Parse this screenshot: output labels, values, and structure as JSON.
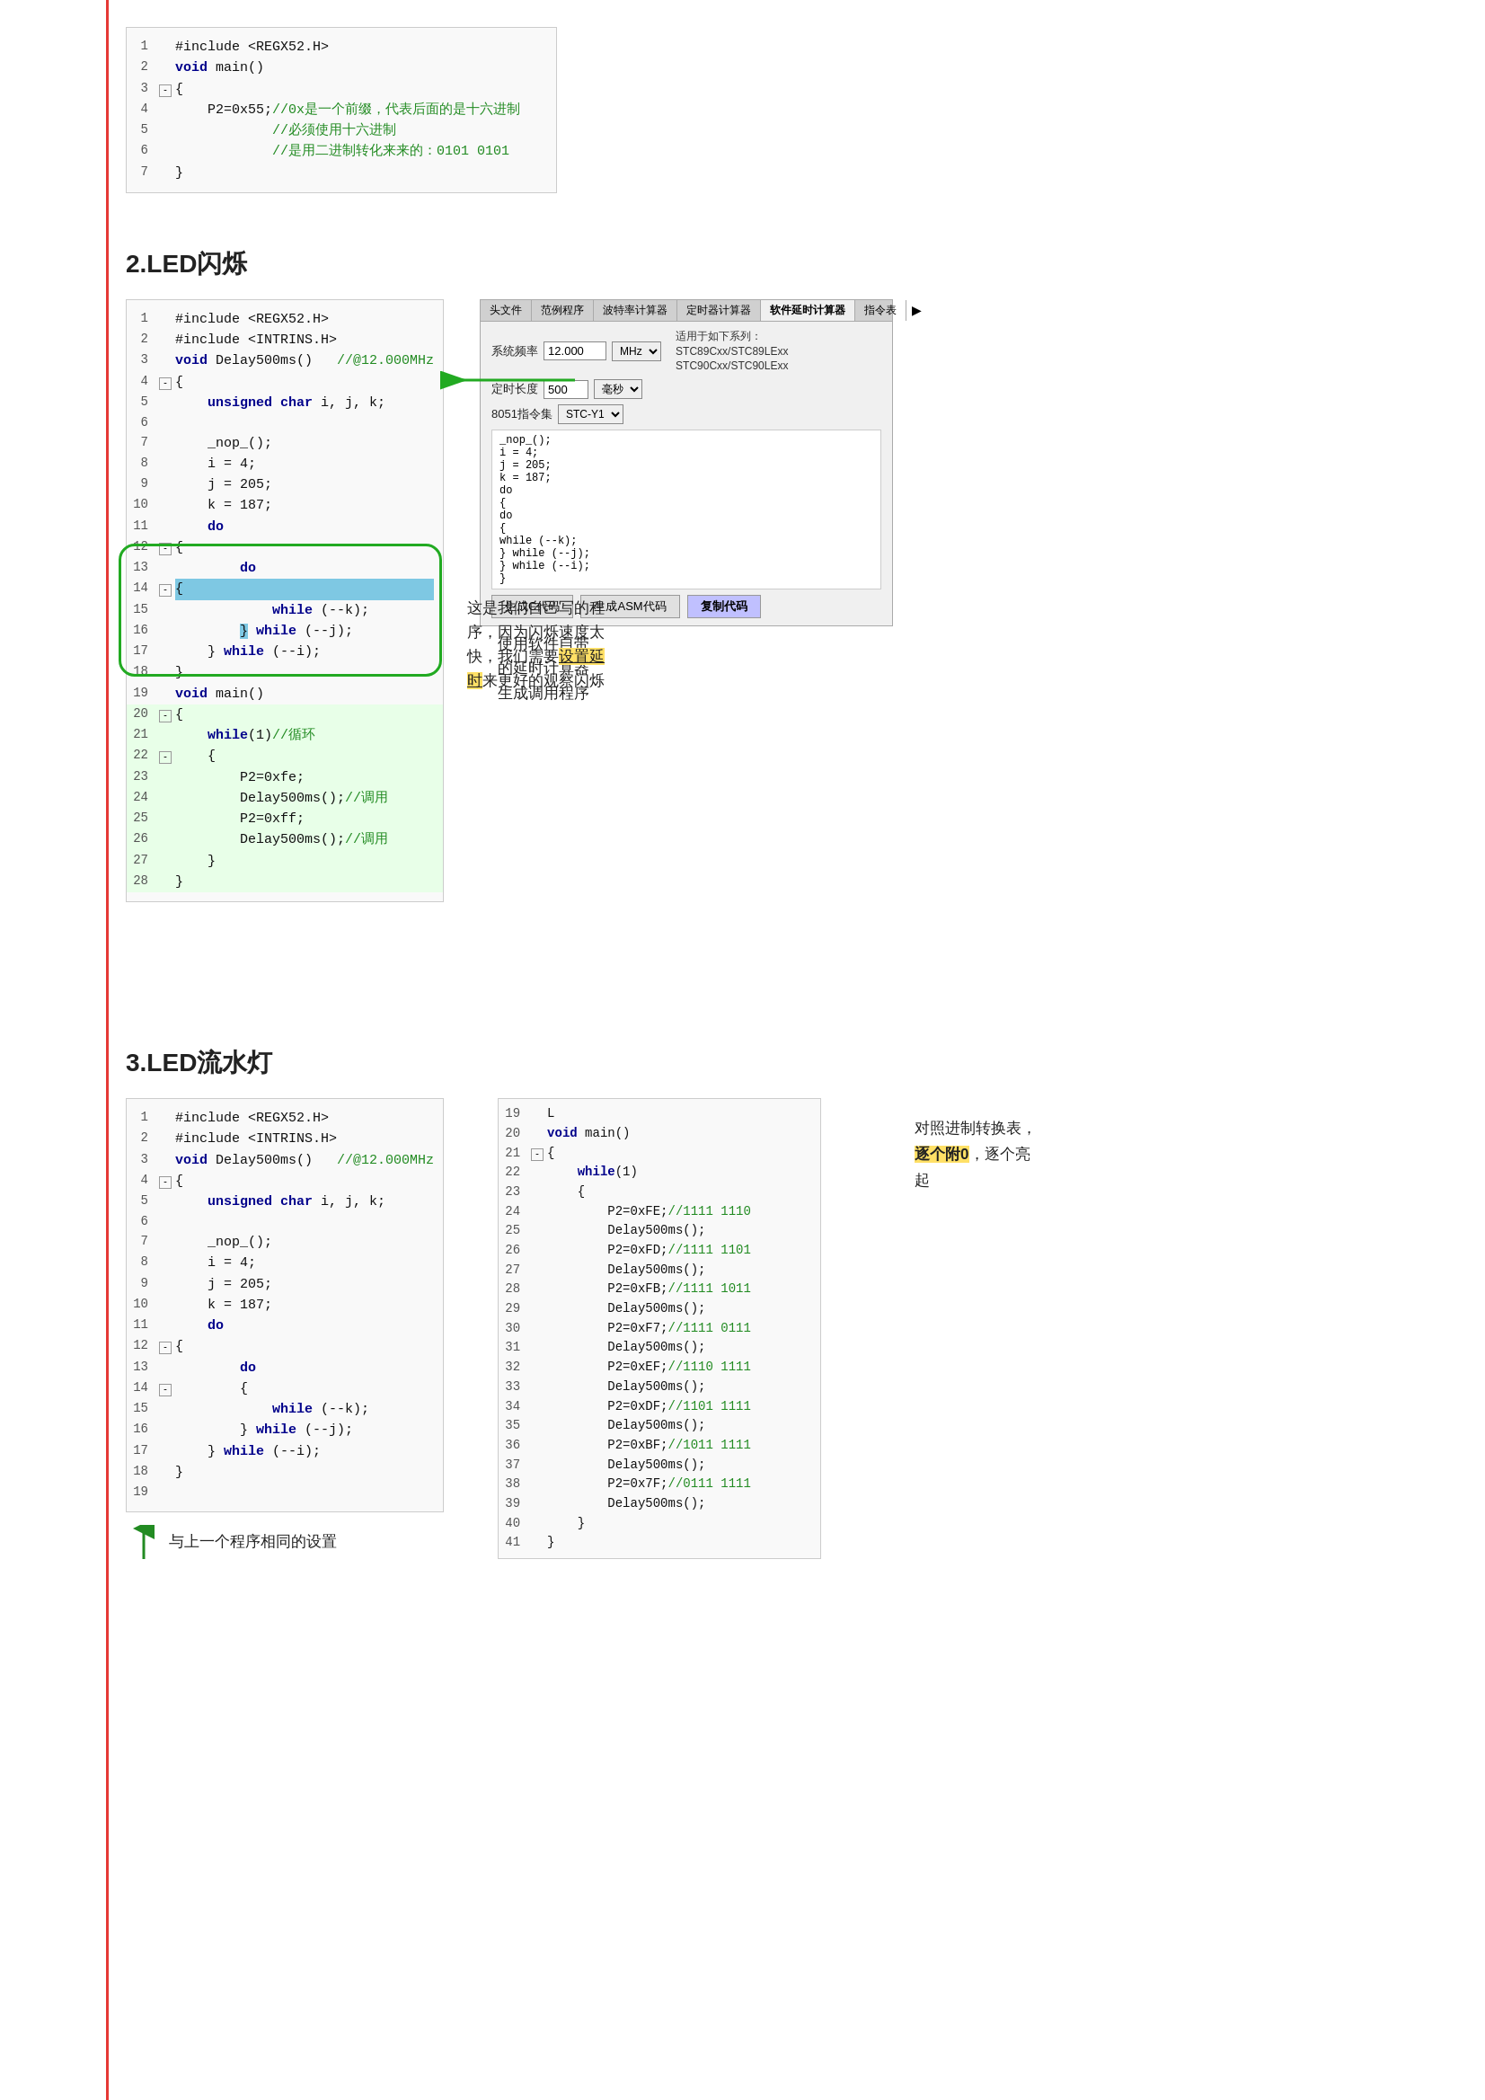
{
  "redLine": true,
  "section1": {
    "code": [
      {
        "num": "1",
        "content": "#include <REGX52.H>",
        "indent": 0
      },
      {
        "num": "2",
        "content": "void main()",
        "indent": 0
      },
      {
        "num": "3",
        "content": "{",
        "indent": 0,
        "fold": true
      },
      {
        "num": "4",
        "content": "    P2=0x55;//0x是一个前缀，代表后面的是十六进制",
        "indent": 0
      },
      {
        "num": "5",
        "content": "            //必须使用十六进制",
        "indent": 0
      },
      {
        "num": "6",
        "content": "            //是用二进制转化来来的：0101 0101",
        "indent": 0
      },
      {
        "num": "7",
        "content": "}",
        "indent": 0
      }
    ]
  },
  "section2": {
    "heading": "2.LED闪烁",
    "leftCode": [
      {
        "num": "1",
        "content": "#include <REGX52.H>"
      },
      {
        "num": "2",
        "content": "#include <INTRINS.H>"
      },
      {
        "num": "3",
        "content": "void Delay500ms()   //@12.000MHz"
      },
      {
        "num": "4",
        "content": "{",
        "fold": true
      },
      {
        "num": "5",
        "content": "    unsigned char i, j, k;"
      },
      {
        "num": "6",
        "content": ""
      },
      {
        "num": "7",
        "content": "    _nop_();"
      },
      {
        "num": "8",
        "content": "    i = 4;"
      },
      {
        "num": "9",
        "content": "    j = 205;"
      },
      {
        "num": "10",
        "content": "    k = 187;"
      },
      {
        "num": "11",
        "content": "    do"
      },
      {
        "num": "12",
        "content": "    {",
        "fold": true
      },
      {
        "num": "13",
        "content": "        do"
      },
      {
        "num": "14",
        "content": "        {",
        "fold": true,
        "highlight": true
      },
      {
        "num": "15",
        "content": "            while (--k);"
      },
      {
        "num": "16",
        "content": "        } while (--j);"
      },
      {
        "num": "17",
        "content": "    } while (--i);"
      },
      {
        "num": "18",
        "content": "}"
      },
      {
        "num": "19",
        "content": "void main()"
      },
      {
        "num": "20",
        "content": "{",
        "fold": true
      },
      {
        "num": "21",
        "content": "    while(1)//循环"
      },
      {
        "num": "22",
        "content": "    {",
        "fold": true
      },
      {
        "num": "23",
        "content": "        P2=0xfe;"
      },
      {
        "num": "24",
        "content": "        Delay500ms();//调用"
      },
      {
        "num": "25",
        "content": "        P2=0xff;"
      },
      {
        "num": "26",
        "content": "        Delay500ms();//调用"
      },
      {
        "num": "27",
        "content": "    }"
      },
      {
        "num": "28",
        "content": "}"
      }
    ],
    "timerBox": {
      "tabs": [
        "头文件",
        "范例程序",
        "波特率计算器",
        "定时器计算器",
        "软件延时计算器",
        "指令表",
        "▶"
      ],
      "activeTab": "软件延时计算器",
      "sysFreqLabel": "系统频率",
      "sysFreqValue": "12.000",
      "sysFreqUnit": "MHz",
      "applicableLabel": "适用于如下系列：",
      "applicableSeries": "STC89Cxx/STC89LExx\nSTC90Cxx/STC90LExx",
      "timerLenLabel": "定时长度",
      "timerLenValue": "500",
      "timerLenUnit": "毫秒",
      "instrSetLabel": "8051指令集",
      "instrSetValue": "STC-Y1",
      "codeLines": [
        "    _nop_();",
        "    i = 4;",
        "    j = 205;",
        "    k = 187;",
        "    do",
        "    {",
        "        do",
        "        {",
        "            while (--k);",
        "        } while (--j);",
        "    } while (--i);",
        "}"
      ],
      "btnGenCode": "生成C代码",
      "btnGenASM": "生成ASM代码",
      "btnCopy": "复制代码"
    },
    "annotation1": "使用软件自带\n的延时计算器\n生成调用程序",
    "annotation2": "这是我们自己写的程序，因为闪烁速度太快，我们需要",
    "annotation2hl": "设置延时",
    "annotation2end": "来更好的观察闪烁"
  },
  "section3": {
    "heading": "3.LED流水灯",
    "leftCode": [
      {
        "num": "1",
        "content": "  #include <REGX52.H>"
      },
      {
        "num": "2",
        "content": "  #include <INTRINS.H>"
      },
      {
        "num": "3",
        "content": "  void Delay500ms()   //@12.000MHz"
      },
      {
        "num": "4",
        "content": "  {",
        "fold": true
      },
      {
        "num": "5",
        "content": "      unsigned char i, j, k;"
      },
      {
        "num": "6",
        "content": ""
      },
      {
        "num": "7",
        "content": "      _nop_();"
      },
      {
        "num": "8",
        "content": "      i = 4;"
      },
      {
        "num": "9",
        "content": "      j = 205;"
      },
      {
        "num": "10",
        "content": "      k = 187;"
      },
      {
        "num": "11",
        "content": "      do"
      },
      {
        "num": "12",
        "content": "      {",
        "fold": true
      },
      {
        "num": "13",
        "content": "          do"
      },
      {
        "num": "14",
        "content": "          {",
        "fold": true
      },
      {
        "num": "15",
        "content": "              while (--k);"
      },
      {
        "num": "16",
        "content": "          } while (--j);"
      },
      {
        "num": "17",
        "content": "      } while (--i);"
      },
      {
        "num": "18",
        "content": "  }"
      },
      {
        "num": "19",
        "content": "  "
      }
    ],
    "rightCode": [
      {
        "num": "19",
        "content": "L"
      },
      {
        "num": "20",
        "content": "  void main()"
      },
      {
        "num": "21",
        "content": "  {",
        "fold": true
      },
      {
        "num": "22",
        "content": "      while(1)"
      },
      {
        "num": "23",
        "content": "      {"
      },
      {
        "num": "24",
        "content": "          P2=0xFE;//1111 1110"
      },
      {
        "num": "25",
        "content": "          Delay500ms();"
      },
      {
        "num": "26",
        "content": "          P2=0xFD;//1111 1101"
      },
      {
        "num": "27",
        "content": "          Delay500ms();"
      },
      {
        "num": "28",
        "content": "          P2=0xFB;//1111 1011"
      },
      {
        "num": "29",
        "content": "          Delay500ms();"
      },
      {
        "num": "30",
        "content": "          P2=0xF7;//1111 0111"
      },
      {
        "num": "31",
        "content": "          Delay500ms();"
      },
      {
        "num": "32",
        "content": "          P2=0xEF;//1110 1111"
      },
      {
        "num": "33",
        "content": "          Delay500ms();"
      },
      {
        "num": "34",
        "content": "          P2=0xDF;//1101 1111"
      },
      {
        "num": "35",
        "content": "          Delay500ms();"
      },
      {
        "num": "36",
        "content": "          P2=0xBF;//1011 1111"
      },
      {
        "num": "37",
        "content": "          Delay500ms();"
      },
      {
        "num": "38",
        "content": "          P2=0x7F;//0111 1111"
      },
      {
        "num": "39",
        "content": "          Delay500ms();"
      },
      {
        "num": "40",
        "content": "      }"
      },
      {
        "num": "41",
        "content": "  }"
      }
    ],
    "annotation": "对照进制转换表，",
    "annotationHl": "逐个附0",
    "annotationEnd": "，逐个亮起",
    "bottomAnnotation": "与上一个程序相同的设置"
  }
}
